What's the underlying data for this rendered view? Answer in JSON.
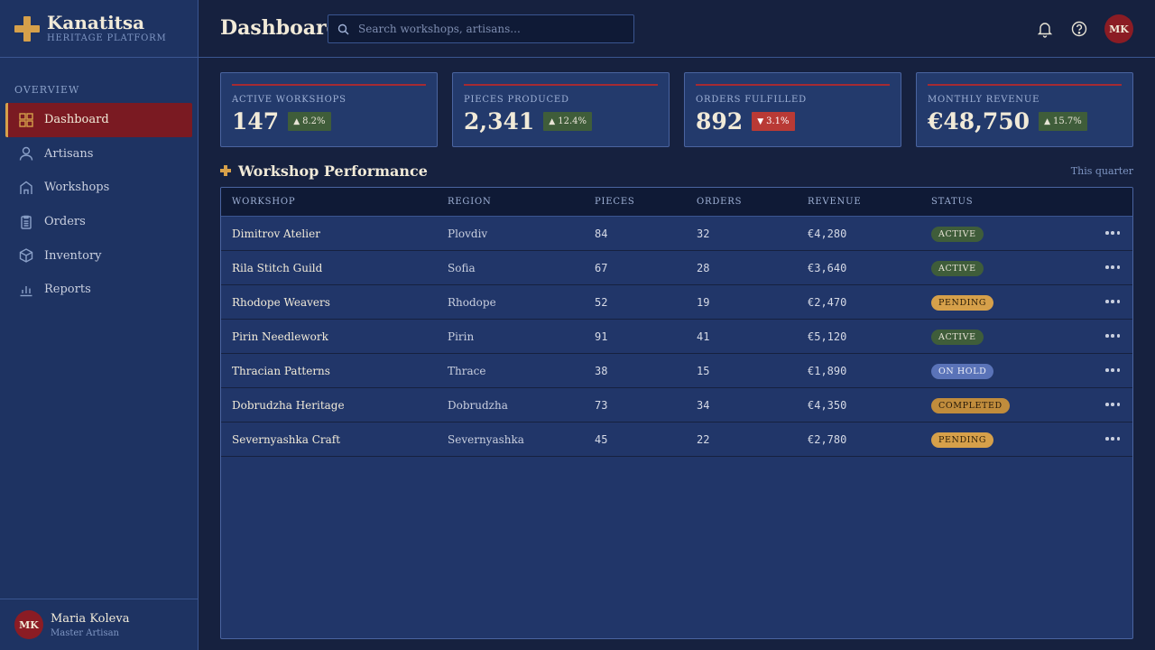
{
  "brand": {
    "name": "Kanatitsa",
    "subtitle": "HERITAGE PLATFORM",
    "icon": "cross-logo-icon"
  },
  "sidebar": {
    "section": "OVERVIEW",
    "items": [
      {
        "label": "Dashboard",
        "icon": "grid-icon",
        "active": true
      },
      {
        "label": "Artisans",
        "icon": "user-icon"
      },
      {
        "label": "Workshops",
        "icon": "house-icon"
      },
      {
        "label": "Orders",
        "icon": "clipboard-icon"
      },
      {
        "label": "Inventory",
        "icon": "box-icon"
      },
      {
        "label": "Reports",
        "icon": "bar-chart-icon"
      }
    ],
    "user": {
      "initials": "MK",
      "name": "Maria Koleva",
      "role": "Master Artisan"
    }
  },
  "header": {
    "title": "Dashboard",
    "search_placeholder": "Search workshops, artisans...",
    "avatar_initials": "MK"
  },
  "stats": [
    {
      "label": "ACTIVE WORKSHOPS",
      "value": "147",
      "delta": "8.2%",
      "direction": "up"
    },
    {
      "label": "PIECES PRODUCED",
      "value": "2,341",
      "delta": "12.4%",
      "direction": "up"
    },
    {
      "label": "ORDERS FULFILLED",
      "value": "892",
      "delta": "3.1%",
      "direction": "down"
    },
    {
      "label": "MONTHLY REVENUE",
      "value": "€48,750",
      "delta": "15.7%",
      "direction": "up"
    }
  ],
  "performance": {
    "title": "Workshop Performance",
    "period": "This quarter",
    "columns": [
      "WORKSHOP",
      "REGION",
      "PIECES",
      "ORDERS",
      "REVENUE",
      "STATUS"
    ],
    "rows": [
      {
        "workshop": "Dimitrov Atelier",
        "region": "Plovdiv",
        "pieces": "84",
        "orders": "32",
        "revenue": "€4,280",
        "status": "ACTIVE",
        "status_type": "active"
      },
      {
        "workshop": "Rila Stitch Guild",
        "region": "Sofia",
        "pieces": "67",
        "orders": "28",
        "revenue": "€3,640",
        "status": "ACTIVE",
        "status_type": "active"
      },
      {
        "workshop": "Rhodope Weavers",
        "region": "Rhodope",
        "pieces": "52",
        "orders": "19",
        "revenue": "€2,470",
        "status": "PENDING",
        "status_type": "pending"
      },
      {
        "workshop": "Pirin Needlework",
        "region": "Pirin",
        "pieces": "91",
        "orders": "41",
        "revenue": "€5,120",
        "status": "ACTIVE",
        "status_type": "active"
      },
      {
        "workshop": "Thracian Patterns",
        "region": "Thrace",
        "pieces": "38",
        "orders": "15",
        "revenue": "€1,890",
        "status": "ON HOLD",
        "status_type": "onhold"
      },
      {
        "workshop": "Dobrudzha Heritage",
        "region": "Dobrudzha",
        "pieces": "73",
        "orders": "34",
        "revenue": "€4,350",
        "status": "COMPLETED",
        "status_type": "completed"
      },
      {
        "workshop": "Severnyashka Craft",
        "region": "Severnyashka",
        "pieces": "45",
        "orders": "22",
        "revenue": "€2,780",
        "status": "PENDING",
        "status_type": "pending"
      }
    ]
  },
  "colors": {
    "accent_gold": "#d6a04a",
    "active_red": "#7a1a22",
    "up_green": "#3f5d3a",
    "down_red": "#b93a35",
    "background": "#16213f",
    "panel": "#1e3362"
  }
}
